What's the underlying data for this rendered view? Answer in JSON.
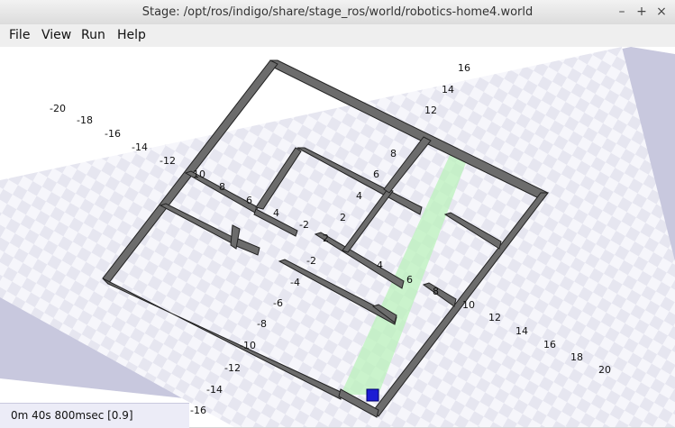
{
  "window": {
    "title": "Stage: /opt/ros/indigo/share/stage_ros/world/robotics-home4.world",
    "minimize_glyph": "–",
    "maximize_glyph": "+",
    "close_glyph": "×"
  },
  "menu": {
    "file": "File",
    "view": "View",
    "run": "Run",
    "help": "Help"
  },
  "axis_labels": {
    "left": [
      "-20",
      "-18",
      "-16",
      "-14",
      "-12",
      "10",
      "8",
      "6",
      "4",
      "-2"
    ],
    "right_top": [
      "16",
      "14",
      "12",
      "8",
      "6",
      "4",
      "2"
    ],
    "center": [
      "-2",
      "-4",
      "-6",
      "-8",
      "-10",
      "-12",
      "-14",
      "-16",
      "2",
      "4",
      "6",
      "8"
    ],
    "bottom_right": [
      "10",
      "12",
      "14",
      "16",
      "18",
      "20"
    ]
  },
  "colors": {
    "wall": "#4a4a4a",
    "laser": "#b8f2b8",
    "robot": "#1c1cd4",
    "grid_light": "#e8e8f2",
    "grid_dark": "#f6f6fb"
  },
  "status": {
    "text": "0m 40s 800msec [0.9]"
  }
}
